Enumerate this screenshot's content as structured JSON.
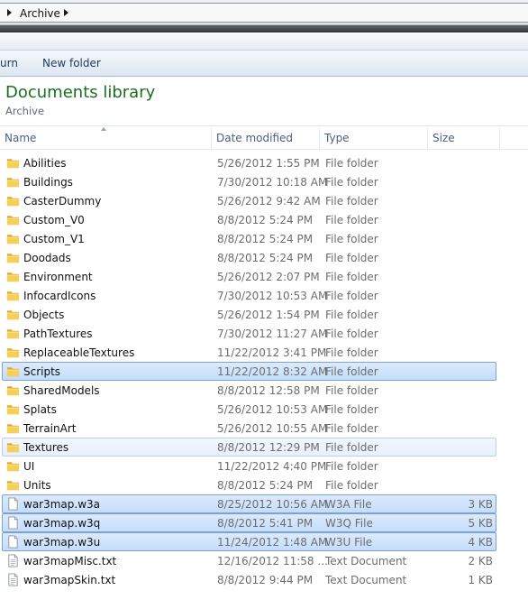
{
  "address": {
    "segments": [
      "Archive"
    ]
  },
  "toolbar": {
    "burn_label": "urn",
    "new_folder_label": "New folder"
  },
  "library": {
    "title": "Documents library",
    "subtitle": "Archive"
  },
  "columns": {
    "name": "Name",
    "date": "Date modified",
    "type": "Type",
    "size": "Size"
  },
  "files": [
    {
      "name": "Abilities",
      "date": "5/26/2012 1:55 PM",
      "type": "File folder",
      "size": "",
      "icon": "folder-icon",
      "state": ""
    },
    {
      "name": "Buildings",
      "date": "7/30/2012 10:18 AM",
      "type": "File folder",
      "size": "",
      "icon": "folder-icon",
      "state": ""
    },
    {
      "name": "CasterDummy",
      "date": "5/26/2012 9:42 AM",
      "type": "File folder",
      "size": "",
      "icon": "folder-icon",
      "state": ""
    },
    {
      "name": "Custom_V0",
      "date": "8/8/2012 5:24 PM",
      "type": "File folder",
      "size": "",
      "icon": "folder-icon",
      "state": ""
    },
    {
      "name": "Custom_V1",
      "date": "8/8/2012 5:24 PM",
      "type": "File folder",
      "size": "",
      "icon": "folder-icon",
      "state": ""
    },
    {
      "name": "Doodads",
      "date": "8/8/2012 5:24 PM",
      "type": "File folder",
      "size": "",
      "icon": "folder-icon",
      "state": ""
    },
    {
      "name": "Environment",
      "date": "5/26/2012 2:07 PM",
      "type": "File folder",
      "size": "",
      "icon": "folder-icon",
      "state": ""
    },
    {
      "name": "InfocardIcons",
      "date": "7/30/2012 10:53 AM",
      "type": "File folder",
      "size": "",
      "icon": "folder-icon",
      "state": ""
    },
    {
      "name": "Objects",
      "date": "5/26/2012 1:54 PM",
      "type": "File folder",
      "size": "",
      "icon": "folder-icon",
      "state": ""
    },
    {
      "name": "PathTextures",
      "date": "7/30/2012 11:27 AM",
      "type": "File folder",
      "size": "",
      "icon": "folder-icon",
      "state": ""
    },
    {
      "name": "ReplaceableTextures",
      "date": "11/22/2012 3:41 PM",
      "type": "File folder",
      "size": "",
      "icon": "folder-icon",
      "state": ""
    },
    {
      "name": "Scripts",
      "date": "11/22/2012 8:32 AM",
      "type": "File folder",
      "size": "",
      "icon": "folder-icon",
      "state": "sel"
    },
    {
      "name": "SharedModels",
      "date": "8/8/2012 12:58 PM",
      "type": "File folder",
      "size": "",
      "icon": "folder-icon",
      "state": ""
    },
    {
      "name": "Splats",
      "date": "5/26/2012 10:53 AM",
      "type": "File folder",
      "size": "",
      "icon": "folder-icon",
      "state": ""
    },
    {
      "name": "TerrainArt",
      "date": "5/26/2012 10:55 AM",
      "type": "File folder",
      "size": "",
      "icon": "folder-icon",
      "state": ""
    },
    {
      "name": "Textures",
      "date": "8/8/2012 12:29 PM",
      "type": "File folder",
      "size": "",
      "icon": "folder-icon",
      "state": "hov"
    },
    {
      "name": "UI",
      "date": "11/22/2012 4:40 PM",
      "type": "File folder",
      "size": "",
      "icon": "folder-icon",
      "state": ""
    },
    {
      "name": "Units",
      "date": "8/8/2012 5:24 PM",
      "type": "File folder",
      "size": "",
      "icon": "folder-icon",
      "state": ""
    },
    {
      "name": "war3map.w3a",
      "date": "8/25/2012 10:56 AM",
      "type": "W3A File",
      "size": "3 KB",
      "icon": "file-icon",
      "state": "sel"
    },
    {
      "name": "war3map.w3q",
      "date": "8/8/2012 5:41 PM",
      "type": "W3Q File",
      "size": "5 KB",
      "icon": "file-icon",
      "state": "sel"
    },
    {
      "name": "war3map.w3u",
      "date": "11/24/2012 1:48 AM",
      "type": "W3U File",
      "size": "4 KB",
      "icon": "file-icon",
      "state": "sel"
    },
    {
      "name": "war3mapMisc.txt",
      "date": "12/16/2012 11:58 ...",
      "type": "Text Document",
      "size": "2 KB",
      "icon": "text-file-icon",
      "state": ""
    },
    {
      "name": "war3mapSkin.txt",
      "date": "8/8/2012 9:44 PM",
      "type": "Text Document",
      "size": "1 KB",
      "icon": "text-file-icon",
      "state": ""
    }
  ]
}
